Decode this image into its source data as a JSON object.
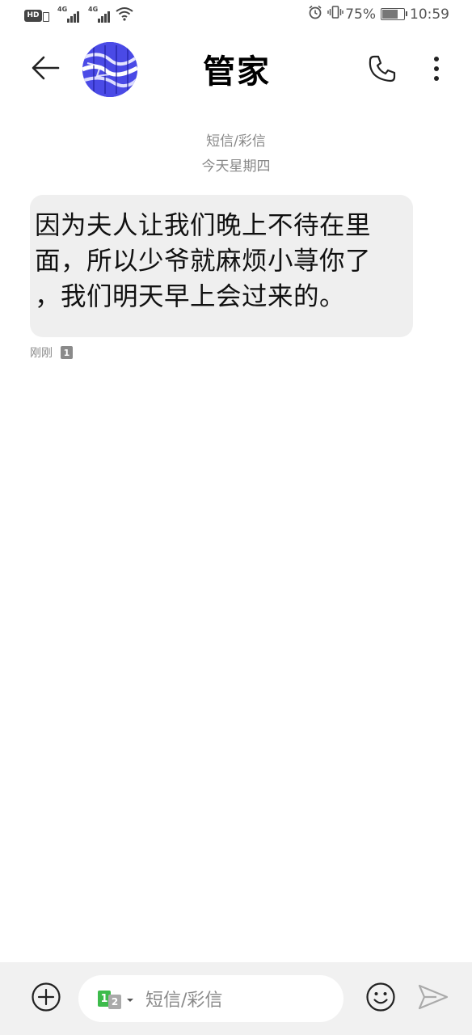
{
  "status_bar": {
    "hd_label": "HD",
    "network1": "4G",
    "network2": "4G",
    "battery_percent": "75%",
    "battery_level": 0.75,
    "time": "10:59"
  },
  "header": {
    "contact_name": "管家"
  },
  "conversation": {
    "message_type": "短信/彩信",
    "date_label": "今天星期四"
  },
  "message": {
    "text": "因为夫人让我们晚上不待在里\n面，所以少爷就麻烦小荨你了\n，我们明天早上会过来的。",
    "time_label": "刚刚",
    "sim_badge": "1"
  },
  "input": {
    "placeholder": "短信/彩信",
    "sim_primary": "1",
    "sim_secondary": "2"
  },
  "colors": {
    "bubble_bg": "#efefef",
    "muted_text": "#888888",
    "sim_green": "#3dbb4b",
    "input_bar_bg": "#f1f1f1"
  },
  "icons": {
    "back": "arrow-left-icon",
    "call": "phone-icon",
    "more": "more-vertical-icon",
    "add": "plus-circle-icon",
    "emoji": "smiley-icon",
    "send": "send-icon"
  }
}
